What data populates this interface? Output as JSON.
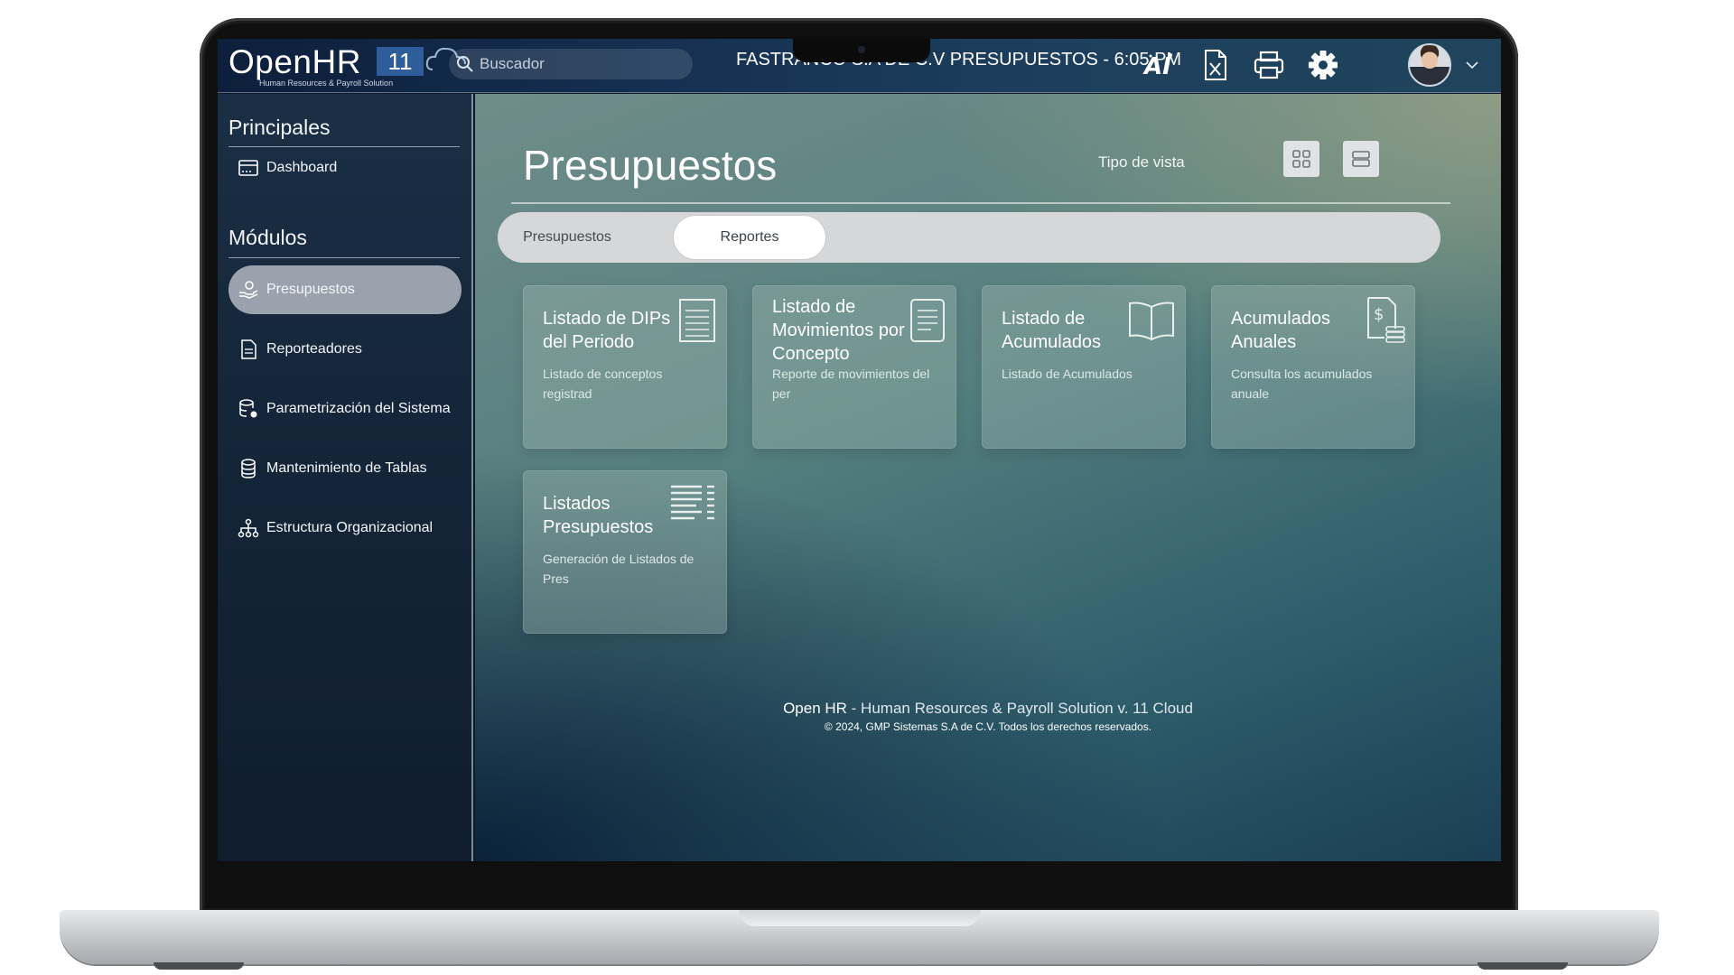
{
  "app": {
    "brand": "OpenHR",
    "version_badge": "11",
    "tagline": "Human Resources & Payroll Solution"
  },
  "search": {
    "placeholder": "Buscador"
  },
  "status_bar": {
    "text": "FASTRANCO S.A DE C.V PRESUPUESTOS - 6:05 PM"
  },
  "toolbar_icons": [
    "ai-icon",
    "excel-export-icon",
    "print-icon",
    "gear-icon",
    "avatar",
    "chevron-down-icon"
  ],
  "sidebar": {
    "principales_heading": "Principales",
    "modulos_heading": "Módulos",
    "items": [
      {
        "label": "Dashboard",
        "icon": "dashboard-icon",
        "active": false
      },
      {
        "label": "Presupuestos",
        "icon": "budget-hand-icon",
        "active": true
      },
      {
        "label": "Reporteadores",
        "icon": "report-file-icon",
        "active": false
      },
      {
        "label": "Parametrización del Sistema",
        "icon": "database-settings-icon",
        "active": false
      },
      {
        "label": "Mantenimiento de Tablas",
        "icon": "database-icon",
        "active": false
      },
      {
        "label": "Estructura Organizacional",
        "icon": "org-chart-icon",
        "active": false
      }
    ]
  },
  "main": {
    "title": "Presupuestos",
    "view_label": "Tipo de vista",
    "tabs": [
      {
        "label": "Presupuestos",
        "active": false
      },
      {
        "label": "Reportes",
        "active": true
      }
    ],
    "cards": [
      {
        "title": "Listado de DIPs del Periodo",
        "desc": "Listado de conceptos registrad",
        "icon": "document-lines-icon"
      },
      {
        "title": "Listado de Movimientos por Concepto",
        "desc": "Reporte de movimientos del per",
        "icon": "document-text-icon"
      },
      {
        "title": "Listado de Acumulados",
        "desc": "Listado de Acumulados",
        "icon": "open-book-icon"
      },
      {
        "title": "Acumulados Anuales",
        "desc": "Consulta los acumulados anuale",
        "icon": "money-document-icon"
      },
      {
        "title": "Listados Presupuestos",
        "desc": "Generación de Listados de Pres",
        "icon": "list-lines-icon"
      }
    ],
    "footer": {
      "brand": "Open HR",
      "line1_rest": " - Human Resources & Payroll Solution v. 11 Cloud",
      "line2": "© 2024, GMP Sistemas S.A de C.V. Todos los derechos reservados."
    }
  },
  "colors": {
    "topbar_bg": "#153052",
    "sidebar_bg": "#16273b",
    "active_item_bg": "#9aa3ad",
    "logo_badge": "#2f5d9a",
    "tab_bar_bg": "#d5d7d8"
  }
}
